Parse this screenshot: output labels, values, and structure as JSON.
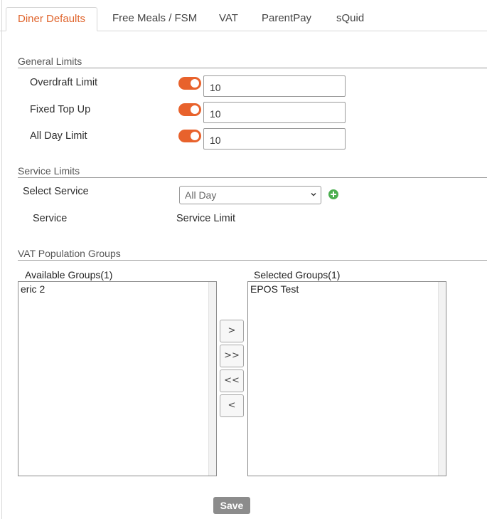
{
  "tabs": [
    {
      "label": "Diner Defaults",
      "active": true
    },
    {
      "label": "Free Meals / FSM"
    },
    {
      "label": "VAT"
    },
    {
      "label": "ParentPay"
    },
    {
      "label": "sQuid"
    }
  ],
  "general_limits": {
    "title": "General Limits",
    "rows": [
      {
        "label": "Overdraft Limit",
        "enabled": true,
        "value": "10"
      },
      {
        "label": "Fixed Top Up",
        "enabled": true,
        "value": "10"
      },
      {
        "label": "All Day Limit",
        "enabled": true,
        "value": "10"
      }
    ]
  },
  "service_limits": {
    "title": "Service Limits",
    "select_label": "Select Service",
    "selected_service": "All Day",
    "col_service": "Service",
    "col_limit": "Service Limit"
  },
  "vat_groups": {
    "title": "VAT Population Groups",
    "available_label": "Available Groups(1)",
    "available": [
      "eric 2"
    ],
    "selected_label": "Selected Groups(1)",
    "selected": [
      "EPOS Test"
    ],
    "buttons": [
      ">",
      ">>",
      "<<",
      "<"
    ]
  },
  "colors": {
    "accent": "#e0652d",
    "toggle_on": "#e8622c",
    "add": "#4caf50"
  },
  "save_label": "Save"
}
